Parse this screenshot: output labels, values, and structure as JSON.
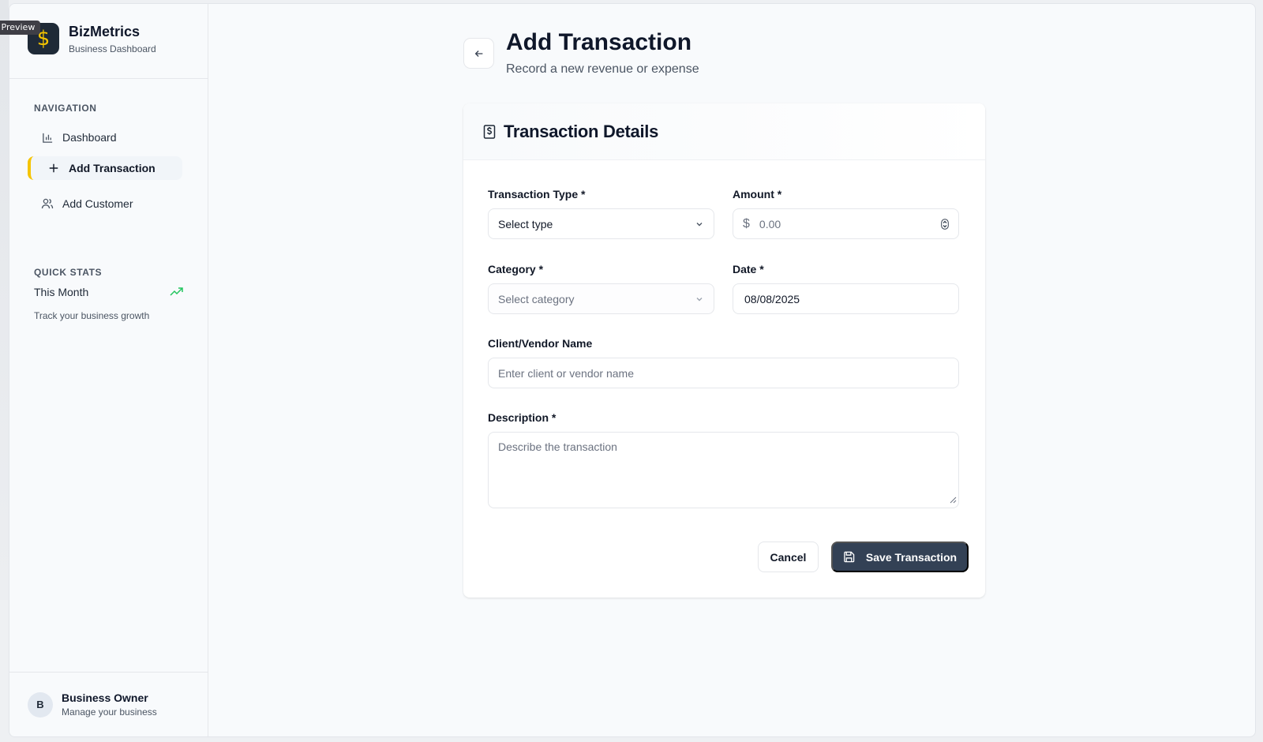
{
  "preview_tag": "Preview",
  "brand": {
    "name": "BizMetrics",
    "subtitle": "Business Dashboard",
    "logo_icon": "dollar-icon"
  },
  "sidebar": {
    "nav_heading": "NAVIGATION",
    "items": [
      {
        "label": "Dashboard",
        "icon": "bar-chart-icon",
        "active": false
      },
      {
        "label": "Add Transaction",
        "icon": "plus-icon",
        "active": true
      },
      {
        "label": "Add Customer",
        "icon": "users-icon",
        "active": false
      }
    ],
    "stats_heading": "QUICK STATS",
    "stats_title": "This Month",
    "stats_subtitle": "Track your business growth",
    "accent_color": "#f5c400",
    "trend_color": "#22c55e"
  },
  "user": {
    "initial": "B",
    "name": "Business Owner",
    "subtitle": "Manage your business"
  },
  "header": {
    "title": "Add Transaction",
    "subtitle": "Record a new revenue or expense"
  },
  "form": {
    "card_title": "Transaction Details",
    "type": {
      "label": "Transaction Type *",
      "value": "Select type"
    },
    "amount": {
      "label": "Amount *",
      "currency": "$",
      "placeholder": "0.00"
    },
    "category": {
      "label": "Category *",
      "value": "Select category"
    },
    "date": {
      "label": "Date *",
      "value": "08/08/2025"
    },
    "client": {
      "label": "Client/Vendor Name",
      "placeholder": "Enter client or vendor name"
    },
    "description": {
      "label": "Description *",
      "placeholder": "Describe the transaction"
    },
    "cancel_label": "Cancel",
    "save_label": "Save Transaction",
    "save_color": "#334155"
  }
}
